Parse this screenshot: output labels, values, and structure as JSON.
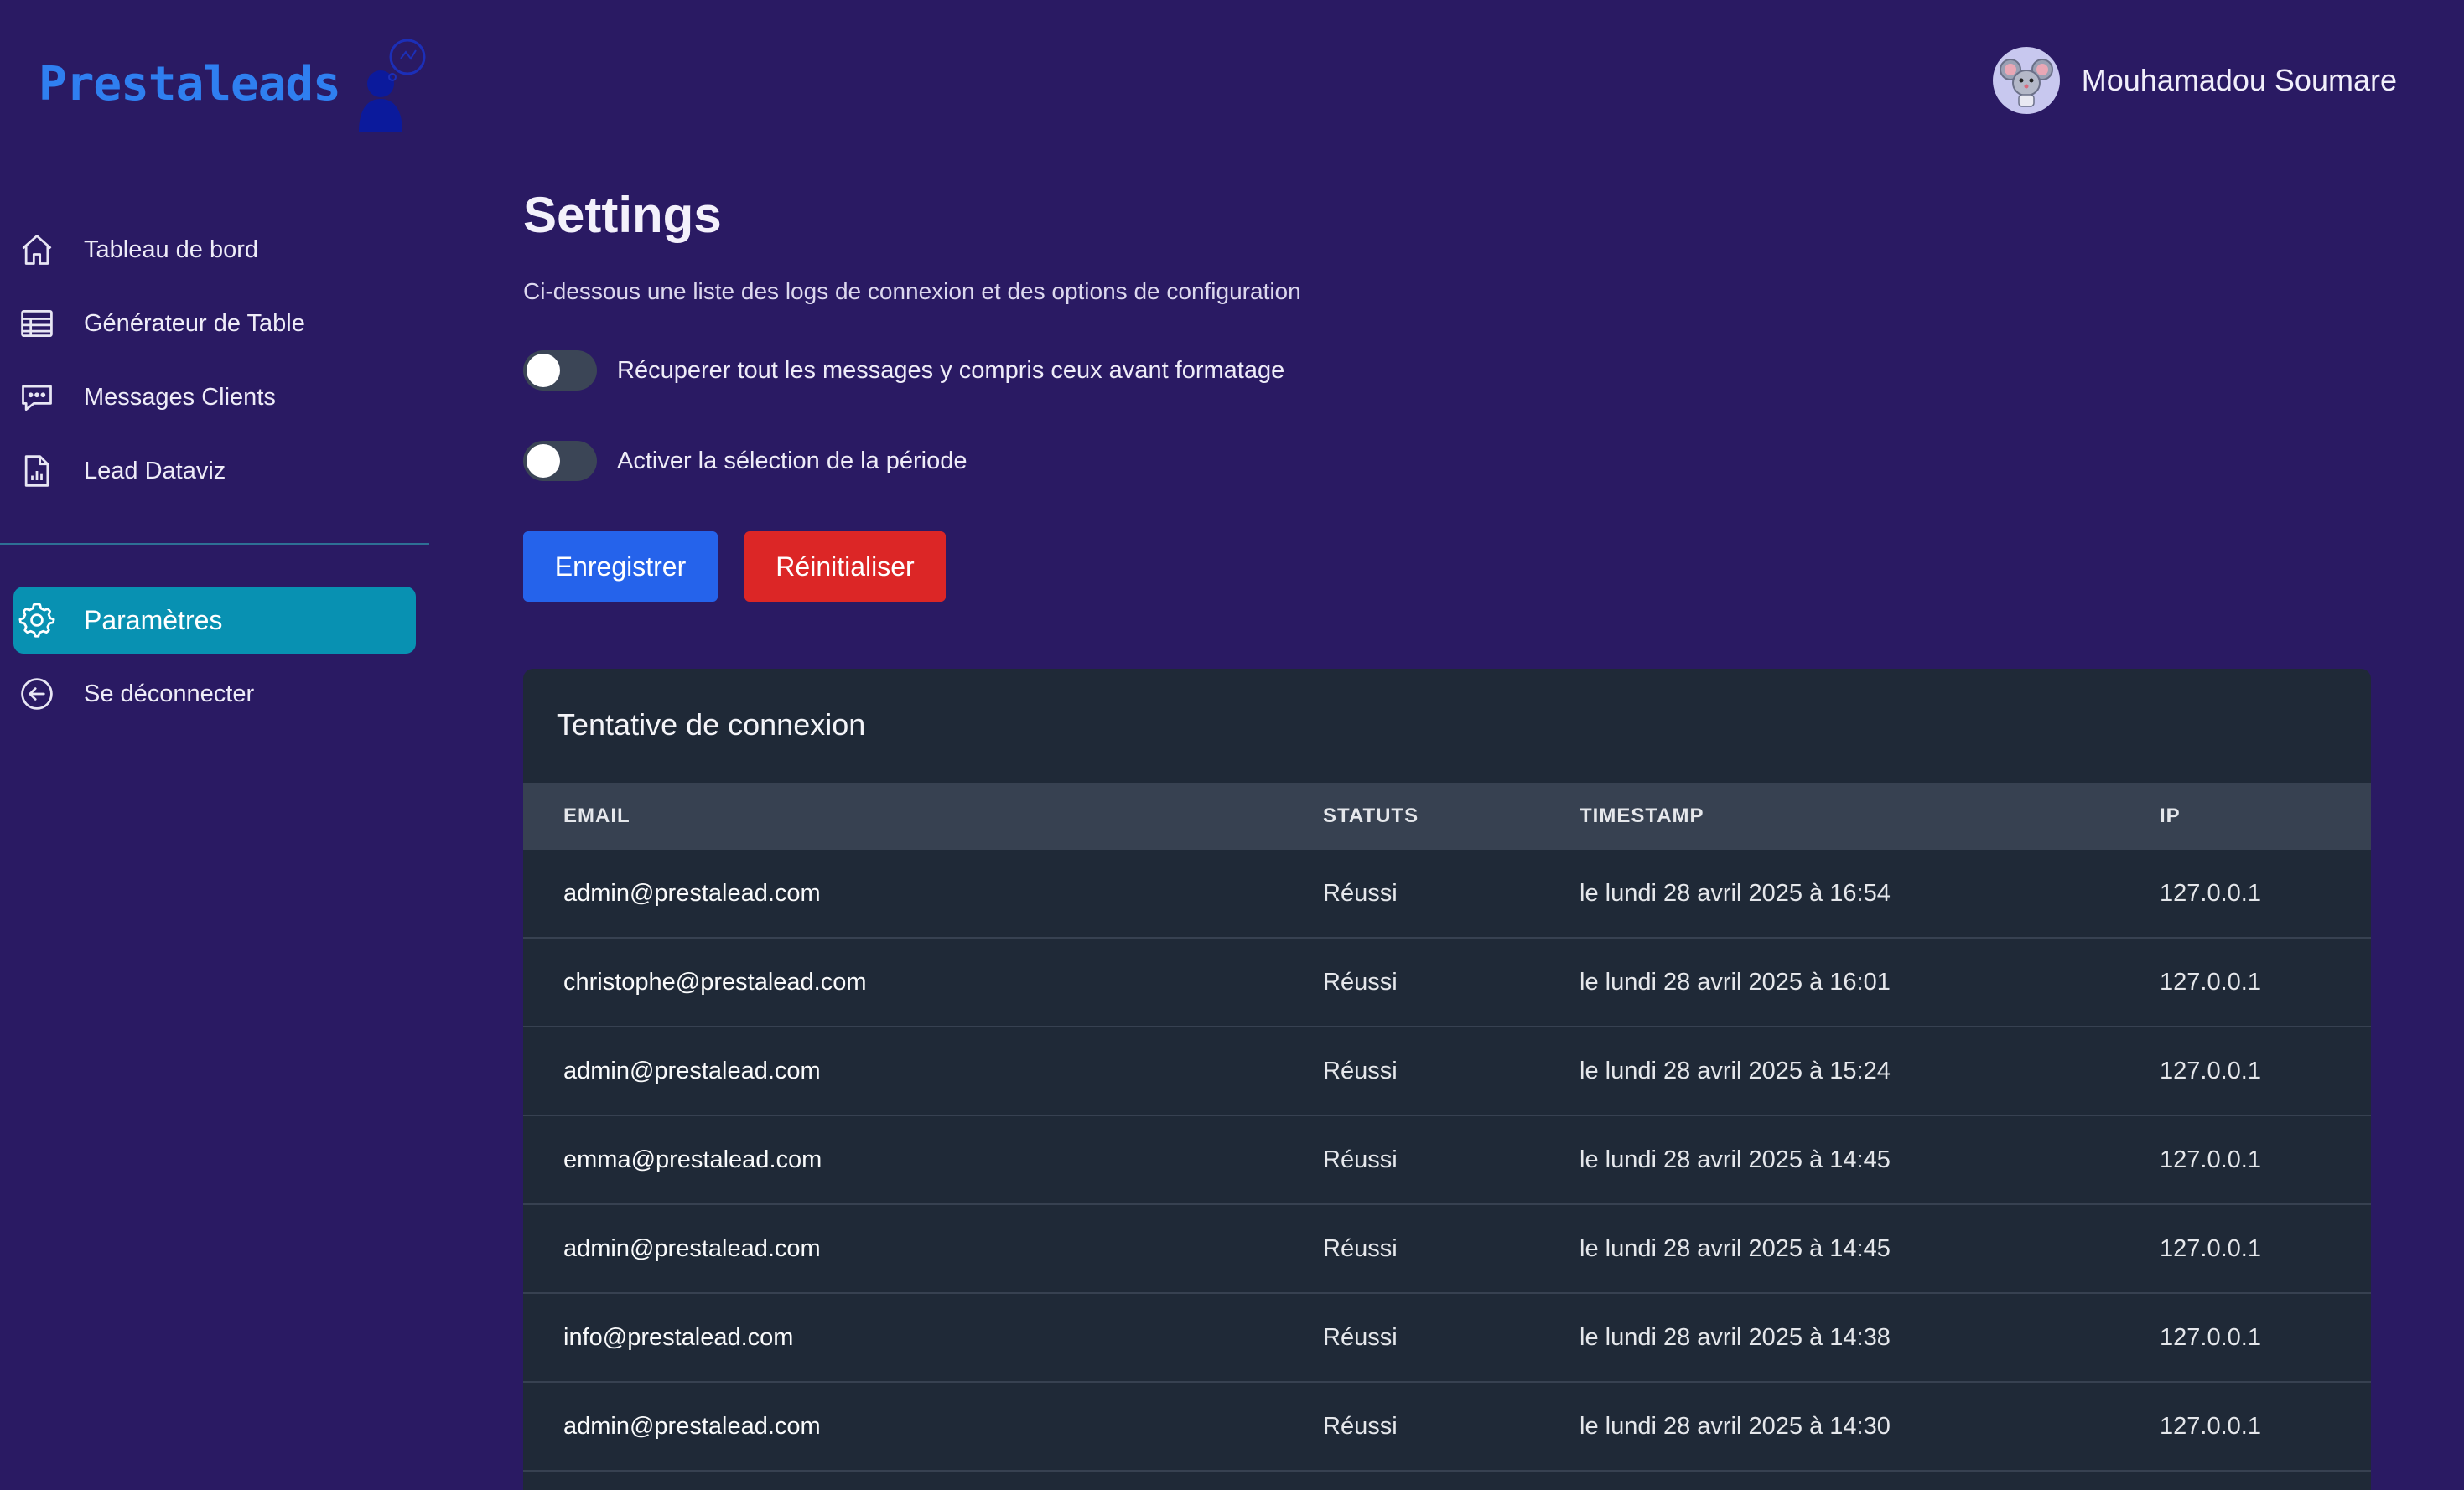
{
  "brand": {
    "name": "Prestaleads"
  },
  "user": {
    "name": "Mouhamadou Soumare"
  },
  "sidebar": {
    "items": [
      {
        "label": "Tableau de bord",
        "icon": "home-icon"
      },
      {
        "label": "Générateur de Table",
        "icon": "table-icon"
      },
      {
        "label": "Messages Clients",
        "icon": "chat-icon"
      },
      {
        "label": "Lead Dataviz",
        "icon": "document-chart-icon"
      }
    ],
    "bottom_items": [
      {
        "label": "Paramètres",
        "icon": "gear-icon",
        "active": true
      },
      {
        "label": "Se déconnecter",
        "icon": "arrow-left-circle-icon"
      }
    ]
  },
  "page": {
    "title": "Settings",
    "subtitle": "Ci-dessous une liste des logs de connexion et des options de configuration"
  },
  "options": [
    {
      "label": "Récuperer tout les messages y compris ceux avant formatage",
      "enabled": false
    },
    {
      "label": "Activer la sélection de la période",
      "enabled": false
    }
  ],
  "buttons": {
    "save": "Enregistrer",
    "reset": "Réinitialiser"
  },
  "table": {
    "title": "Tentative de connexion",
    "headers": [
      "EMAIL",
      "STATUTS",
      "TIMESTAMP",
      "IP"
    ],
    "rows": [
      [
        "admin@prestalead.com",
        "Réussi",
        "le lundi 28 avril 2025 à 16:54",
        "127.0.0.1"
      ],
      [
        "christophe@prestalead.com",
        "Réussi",
        "le lundi 28 avril 2025 à 16:01",
        "127.0.0.1"
      ],
      [
        "admin@prestalead.com",
        "Réussi",
        "le lundi 28 avril 2025 à 15:24",
        "127.0.0.1"
      ],
      [
        "emma@prestalead.com",
        "Réussi",
        "le lundi 28 avril 2025 à 14:45",
        "127.0.0.1"
      ],
      [
        "admin@prestalead.com",
        "Réussi",
        "le lundi 28 avril 2025 à 14:45",
        "127.0.0.1"
      ],
      [
        "info@prestalead.com",
        "Réussi",
        "le lundi 28 avril 2025 à 14:38",
        "127.0.0.1"
      ],
      [
        "admin@prestalead.com",
        "Réussi",
        "le lundi 28 avril 2025 à 14:30",
        "127.0.0.1"
      ]
    ]
  },
  "colors": {
    "background": "#2a1a63",
    "brand": "#2f7ff0",
    "active_nav": "#0891b2",
    "save_button": "#2563eb",
    "reset_button": "#dc2626",
    "card": "#1f2937",
    "table_header": "#374151"
  }
}
